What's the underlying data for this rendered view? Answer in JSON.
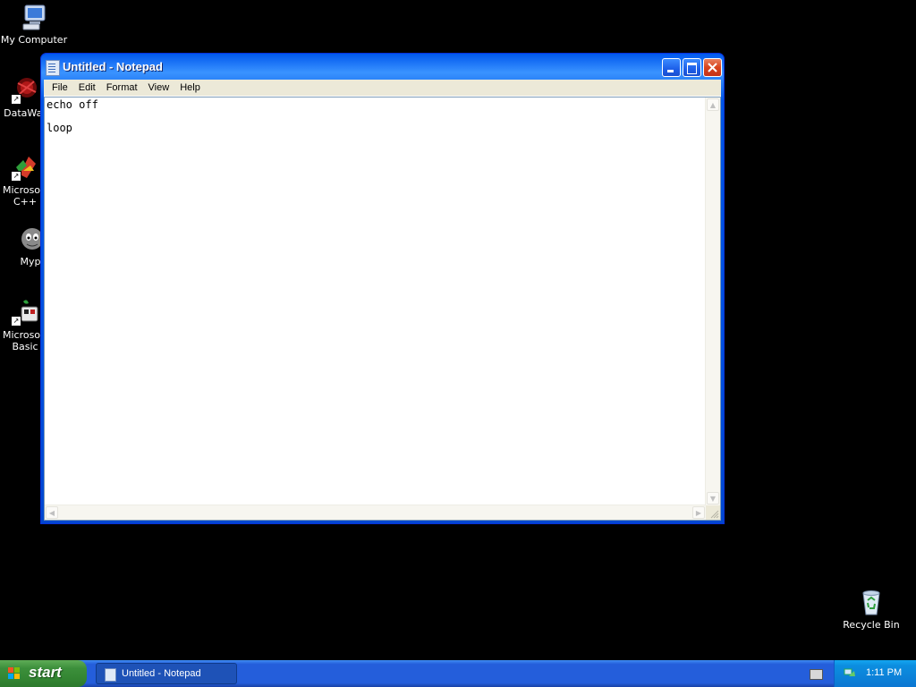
{
  "desktop": {
    "icons": [
      {
        "label": "My Computer",
        "icon": "my-computer-icon"
      },
      {
        "label": "DataWar",
        "icon": "datawar-icon"
      },
      {
        "label": "Microsoft\nC++",
        "label_line1": "Microsoft",
        "label_line2": "C++",
        "icon": "visual-cpp-icon"
      },
      {
        "label": "Myp",
        "icon": "myp-icon"
      },
      {
        "label_line1": "Microsoft",
        "label_line2": "Basic",
        "icon": "visual-basic-icon"
      },
      {
        "label": "Recycle Bin",
        "icon": "recycle-bin-icon"
      }
    ]
  },
  "window": {
    "title": "Untitled - Notepad",
    "menu": [
      "File",
      "Edit",
      "Format",
      "View",
      "Help"
    ],
    "content_lines": [
      "echo off",
      "",
      "loop"
    ]
  },
  "taskbar": {
    "start_label": "start",
    "task_button_label": "Untitled - Notepad",
    "clock": "1:11 PM"
  },
  "colors": {
    "title_bar_blue": "#0054e3",
    "taskbar_blue": "#245edb",
    "start_green": "#3c8f3b",
    "close_red": "#d9441c"
  }
}
